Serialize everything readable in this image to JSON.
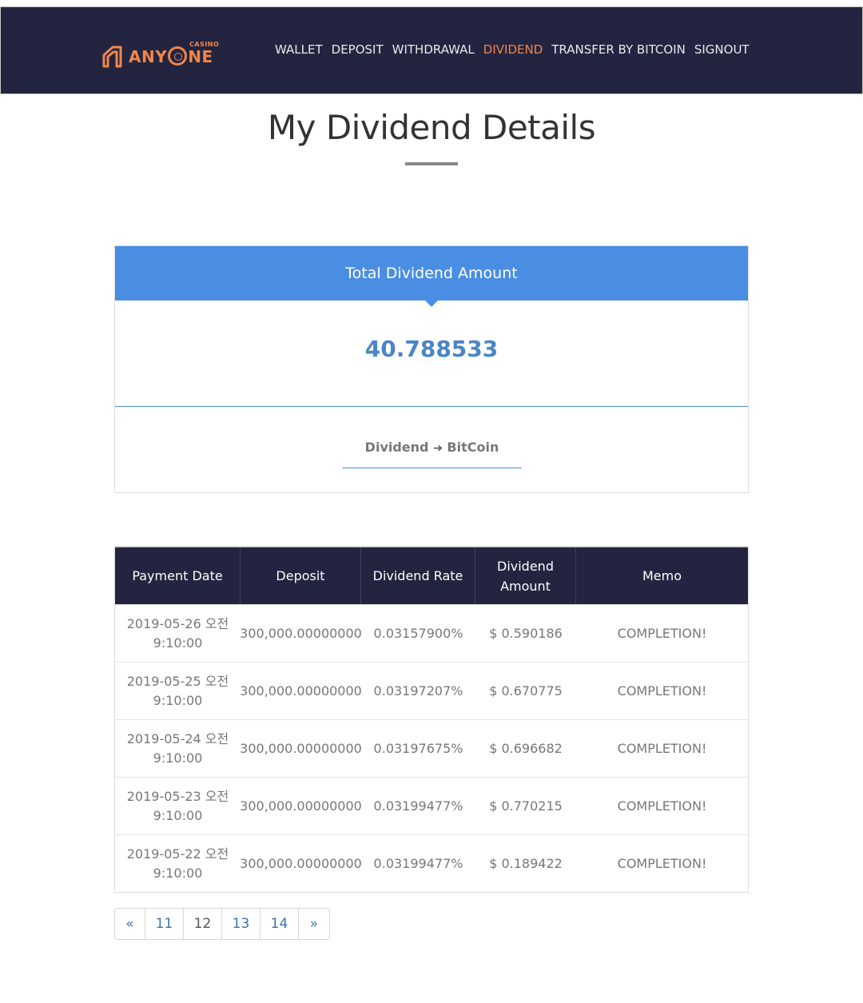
{
  "header": {
    "logo_text_pre": "ANY",
    "logo_text_post": "NE",
    "logo_casino": "CASINO",
    "nav": [
      {
        "label": "WALLET"
      },
      {
        "label": "DEPOSIT"
      },
      {
        "label": "WITHDRAWAL"
      },
      {
        "label": "DIVIDEND"
      },
      {
        "label": "TRANSFER BY BITCOIN"
      },
      {
        "label": "SIGNOUT"
      }
    ],
    "active_nav": "DIVIDEND",
    "accent_color": "#f0864a",
    "bg_color": "#23243f"
  },
  "page": {
    "title": "My Dividend Details"
  },
  "summary": {
    "heading": "Total Dividend Amount",
    "amount": "40.788533",
    "convert_pre": "Dividend",
    "convert_arrow": "➔",
    "convert_post": "BitCoin",
    "heading_color": "#4a8ee3"
  },
  "table": {
    "headers": [
      "Payment Date",
      "Deposit",
      "Dividend Rate",
      "Dividend\nAmount",
      "Memo"
    ],
    "header_lines": {
      "dividend_amount_1": "Dividend",
      "dividend_amount_2": "Amount"
    },
    "rows": [
      {
        "date": "2019-05-26 오전",
        "time": "9:10:00",
        "deposit": "300,000.00000000",
        "rate": "0.03157900%",
        "amount": "$ 0.590186",
        "memo": "COMPLETION!"
      },
      {
        "date": "2019-05-25 오전",
        "time": "9:10:00",
        "deposit": "300,000.00000000",
        "rate": "0.03197207%",
        "amount": "$ 0.670775",
        "memo": "COMPLETION!"
      },
      {
        "date": "2019-05-24 오전",
        "time": "9:10:00",
        "deposit": "300,000.00000000",
        "rate": "0.03197675%",
        "amount": "$ 0.696682",
        "memo": "COMPLETION!"
      },
      {
        "date": "2019-05-23 오전",
        "time": "9:10:00",
        "deposit": "300,000.00000000",
        "rate": "0.03199477%",
        "amount": "$ 0.770215",
        "memo": "COMPLETION!"
      },
      {
        "date": "2019-05-22 오전",
        "time": "9:10:00",
        "deposit": "300,000.00000000",
        "rate": "0.03199477%",
        "amount": "$ 0.189422",
        "memo": "COMPLETION!"
      }
    ]
  },
  "pagination": {
    "prev": "«",
    "pages": [
      "11",
      "12",
      "13",
      "14"
    ],
    "current": "12",
    "next": "»"
  }
}
